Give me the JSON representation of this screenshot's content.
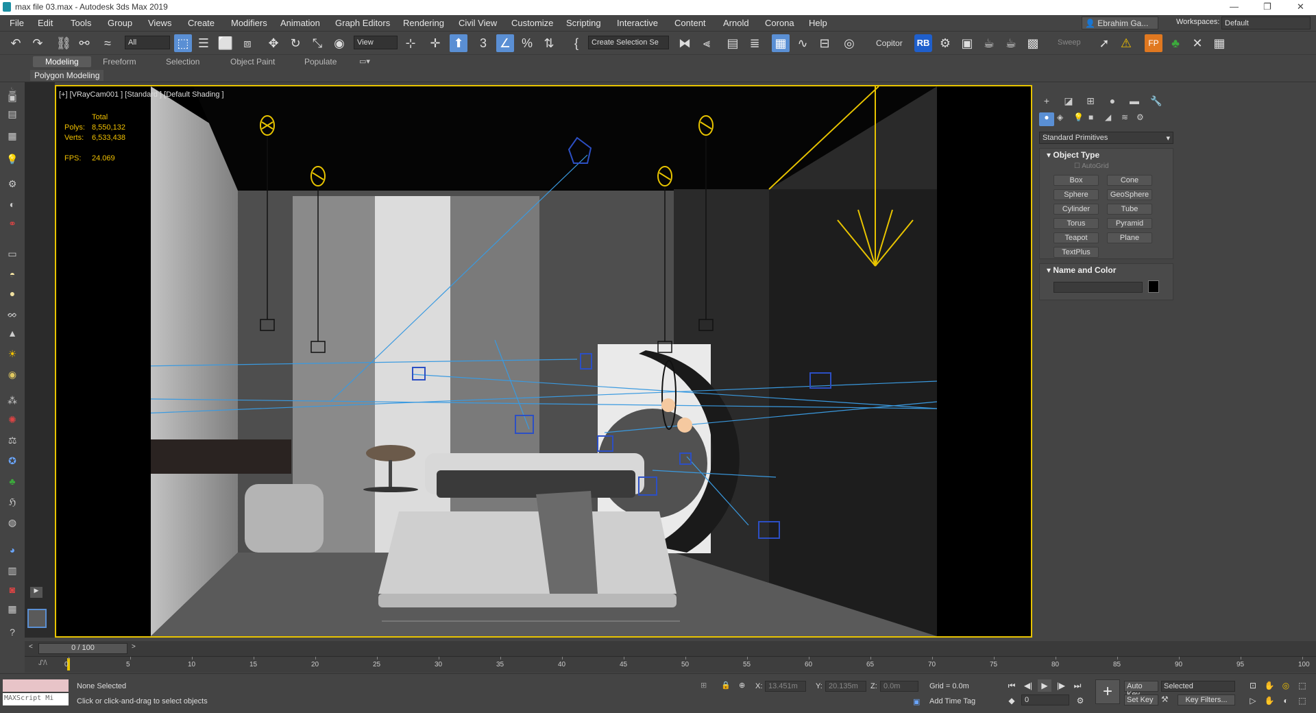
{
  "app": {
    "title": "max file 03.max - Autodesk 3ds Max 2019"
  },
  "menu": [
    "File",
    "Edit",
    "Tools",
    "Group",
    "Views",
    "Create",
    "Modifiers",
    "Animation",
    "Graph Editors",
    "Rendering",
    "Civil View",
    "Customize",
    "Scripting",
    "Interactive",
    "Content",
    "Arnold",
    "Corona",
    "Help"
  ],
  "user": {
    "name": "Ebrahim Ga...",
    "workspaces_label": "Workspaces:",
    "workspace": "Default"
  },
  "toolbar": {
    "filter": "All",
    "ref_coord": "View",
    "selection_set": "Create Selection Se",
    "copitor": "Copitor",
    "sweep": "Sweep"
  },
  "ribbon": {
    "tabs": [
      "Modeling",
      "Freeform",
      "Selection",
      "Object Paint",
      "Populate"
    ],
    "active_tab": "Modeling",
    "sub": "Polygon Modeling"
  },
  "viewport": {
    "label": "[+] [VRayCam001 ] [Standard ] [Default Shading ]",
    "stats": {
      "total_label": "Total",
      "polys_label": "Polys:",
      "polys": "8,550,132",
      "verts_label": "Verts:",
      "verts": "6,533,438",
      "fps_label": "FPS:",
      "fps": "24.069"
    }
  },
  "command_panel": {
    "category": "Standard Primitives",
    "object_type_title": "Object Type",
    "autogrid": "AutoGrid",
    "buttons": [
      "Box",
      "Cone",
      "Sphere",
      "GeoSphere",
      "Cylinder",
      "Tube",
      "Torus",
      "Pyramid",
      "Teapot",
      "Plane",
      "TextPlus"
    ],
    "name_color_title": "Name and Color"
  },
  "timeline": {
    "frame": "0 / 100",
    "ticks": [
      "0",
      "5",
      "10",
      "15",
      "20",
      "25",
      "30",
      "35",
      "40",
      "45",
      "50",
      "55",
      "60",
      "65",
      "70",
      "75",
      "80",
      "85",
      "90",
      "95",
      "100"
    ]
  },
  "status": {
    "maxscript": "MAXScript Mi",
    "selection": "None Selected",
    "prompt": "Click or click-and-drag to select objects",
    "x_label": "X:",
    "x": "13.451m",
    "y_label": "Y:",
    "y": "20.135m",
    "z_label": "Z:",
    "z": "0.0m",
    "grid": "Grid = 0.0m",
    "add_time_tag": "Add Time Tag",
    "auto_key": "Auto Key",
    "selected": "Selected",
    "set_key": "Set Key",
    "key_filters": "Key Filters...",
    "frame_field": "0"
  },
  "colors": {
    "accent": "#5a8fd4",
    "viewport_border": "#e8c400",
    "stat_text": "#f0c000",
    "lights": "#e8c400",
    "cameras": "#3a7ad8"
  }
}
